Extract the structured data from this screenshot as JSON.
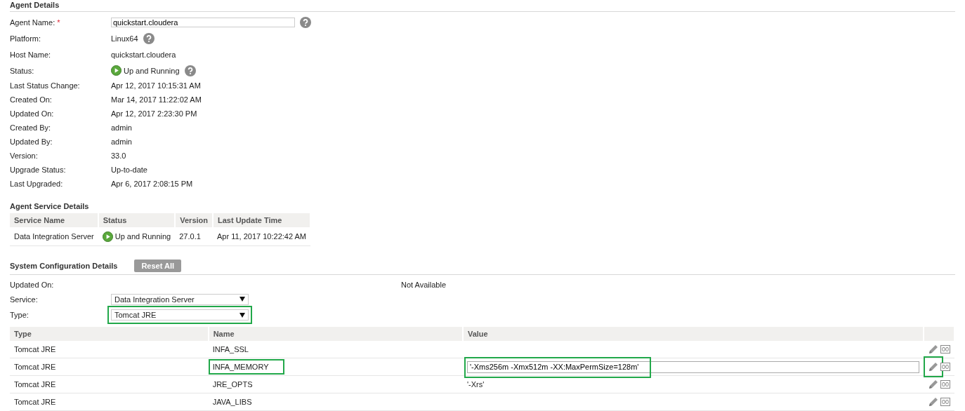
{
  "agent_details": {
    "title": "Agent Details",
    "fields": [
      {
        "kind": "input",
        "label": "Agent Name:",
        "required_mark": "*",
        "value": "quickstart.cloudera",
        "help": true
      },
      {
        "kind": "text",
        "label": "Platform:",
        "value": "Linux64",
        "help": true
      },
      {
        "kind": "text",
        "label": "Host Name:",
        "value": "quickstart.cloudera",
        "help": false
      },
      {
        "kind": "status",
        "label": "Status:",
        "value": "Up and Running",
        "help": true
      },
      {
        "kind": "text",
        "label": "Last Status Change:",
        "value": "Apr 12, 2017 10:15:31 AM",
        "help": false
      },
      {
        "kind": "text",
        "label": "Created On:",
        "value": "Mar 14, 2017 11:22:02 AM",
        "help": false
      },
      {
        "kind": "text",
        "label": "Updated On:",
        "value": "Apr 12, 2017 2:23:30 PM",
        "help": false
      },
      {
        "kind": "text",
        "label": "Created By:",
        "value": "admin",
        "help": false
      },
      {
        "kind": "text",
        "label": "Updated By:",
        "value": "admin",
        "help": false
      },
      {
        "kind": "text",
        "label": "Version:",
        "value": "33.0",
        "help": false
      },
      {
        "kind": "text",
        "label": "Upgrade Status:",
        "value": "Up-to-date",
        "help": false
      },
      {
        "kind": "text",
        "label": "Last Upgraded:",
        "value": "Apr 6, 2017 2:08:15 PM",
        "help": false
      }
    ]
  },
  "agent_service_details": {
    "title": "Agent Service Details",
    "columns": [
      "Service Name",
      "Status",
      "Version",
      "Last Update Time"
    ],
    "rows": [
      {
        "service_name": "Data Integration Server",
        "status": "Up and Running",
        "version": "27.0.1",
        "last_update_time": "Apr 11, 2017 10:22:42 AM"
      }
    ]
  },
  "system_configuration": {
    "title": "System Configuration Details",
    "reset_button": "Reset All",
    "updated_on": {
      "label": "Updated On:",
      "value": "Not Available"
    },
    "service": {
      "label": "Service:",
      "value": "Data Integration Server"
    },
    "type": {
      "label": "Type:",
      "value": "Tomcat JRE",
      "highlighted": true
    },
    "columns": [
      "Type",
      "Name",
      "Value"
    ],
    "rows": [
      {
        "type": "Tomcat JRE",
        "name": "INFA_SSL",
        "value": "",
        "editing": false,
        "name_highlighted": false,
        "edit_highlighted": false,
        "action_label": "00"
      },
      {
        "type": "Tomcat JRE",
        "name": "INFA_MEMORY",
        "value": "'-Xms256m -Xmx512m -XX:MaxPermSize=128m'",
        "editing": true,
        "name_highlighted": true,
        "edit_highlighted": true,
        "action_label": "00"
      },
      {
        "type": "Tomcat JRE",
        "name": "JRE_OPTS",
        "value": "'-Xrs'",
        "editing": false,
        "name_highlighted": false,
        "edit_highlighted": false,
        "action_label": "00"
      },
      {
        "type": "Tomcat JRE",
        "name": "JAVA_LIBS",
        "value": "",
        "editing": false,
        "name_highlighted": false,
        "edit_highlighted": false,
        "action_label": "00"
      }
    ]
  }
}
